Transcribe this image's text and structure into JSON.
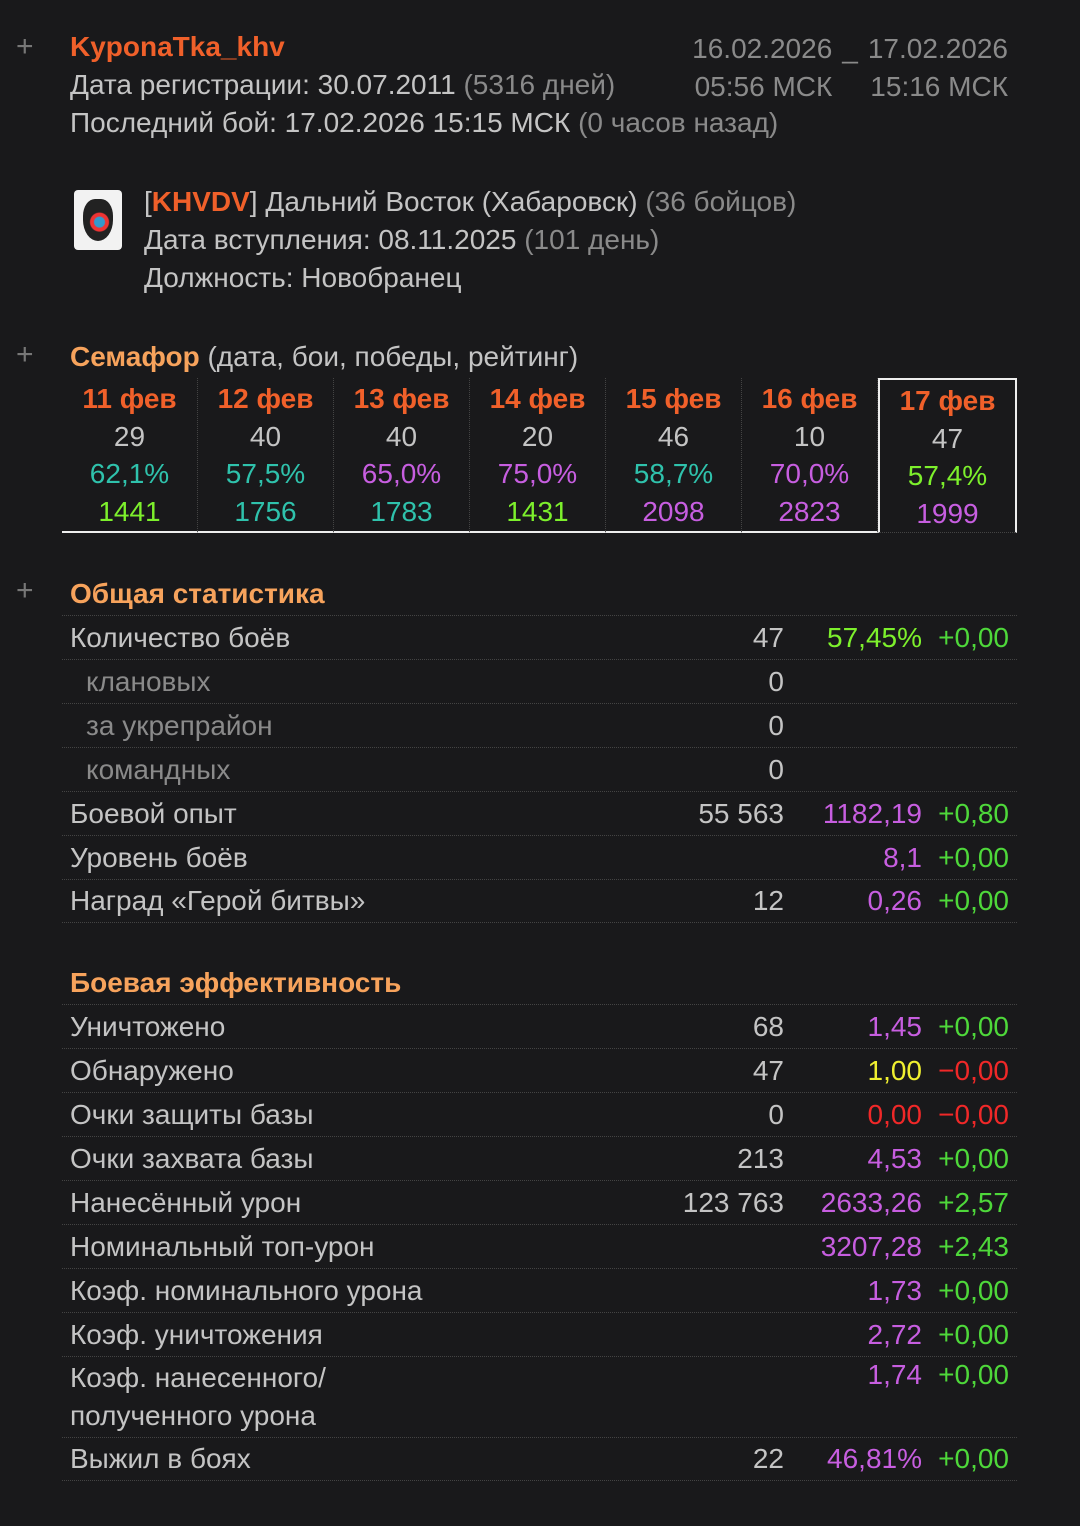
{
  "player": {
    "name": "KyponaTka_khv",
    "reg_label": "Дата регистрации: 30.07.2011",
    "reg_days": "(5316 дней)",
    "last_label": "Последний бой: 17.02.2026 15:15 МСК",
    "last_ago": "(0 часов назад)"
  },
  "period": {
    "from_date": "16.02.2026",
    "sep": "_",
    "to_date": "17.02.2026",
    "from_time": "05:56 МСК",
    "to_time": "15:16 МСК"
  },
  "clan": {
    "open": "[",
    "tag": "KHVDV",
    "close": "]",
    "name": "Дальний Восток (Хабаровск)",
    "members": "(36 бойцов)",
    "joined": "Дата вступления: 08.11.2025",
    "joined_days": "(101 день)",
    "role": "Должность: Новобранец"
  },
  "semaphore": {
    "title": "Семафор",
    "subtitle": "(дата, бои, победы, рейтинг)",
    "days": [
      {
        "date": "11 фев",
        "battles": "29",
        "wins": "62,1%",
        "wins_color": "c",
        "rating": "1441",
        "rating_color": "g"
      },
      {
        "date": "12 фев",
        "battles": "40",
        "wins": "57,5%",
        "wins_color": "c",
        "rating": "1756",
        "rating_color": "c"
      },
      {
        "date": "13 фев",
        "battles": "40",
        "wins": "65,0%",
        "wins_color": "p",
        "rating": "1783",
        "rating_color": "c"
      },
      {
        "date": "14 фев",
        "battles": "20",
        "wins": "75,0%",
        "wins_color": "p",
        "rating": "1431",
        "rating_color": "g"
      },
      {
        "date": "15 фев",
        "battles": "46",
        "wins": "58,7%",
        "wins_color": "c",
        "rating": "2098",
        "rating_color": "p"
      },
      {
        "date": "16 фев",
        "battles": "10",
        "wins": "70,0%",
        "wins_color": "p",
        "rating": "2823",
        "rating_color": "p"
      },
      {
        "date": "17 фев",
        "battles": "47",
        "wins": "57,4%",
        "wins_color": "g",
        "rating": "1999",
        "rating_color": "p"
      }
    ]
  },
  "general": {
    "title": "Общая статистика",
    "rows": [
      {
        "label": "Количество боёв",
        "value": "47",
        "ratio": "57,45%",
        "rc": "g",
        "delta": "+0,00",
        "dc": "gd"
      },
      {
        "label": "клановых",
        "value": "0",
        "ratio": "",
        "rc": "",
        "delta": "",
        "dc": "",
        "sub": true
      },
      {
        "label": "за укрепрайон",
        "value": "0",
        "ratio": "",
        "rc": "",
        "delta": "",
        "dc": "",
        "sub": true
      },
      {
        "label": "командных",
        "value": "0",
        "ratio": "",
        "rc": "",
        "delta": "",
        "dc": "",
        "sub": true
      },
      {
        "label": "Боевой опыт",
        "value": "55 563",
        "ratio": "1182,19",
        "rc": "p",
        "delta": "+0,80",
        "dc": "gd"
      },
      {
        "label": "Уровень боёв",
        "value": "",
        "ratio": "8,1",
        "rc": "p",
        "delta": "+0,00",
        "dc": "gd"
      },
      {
        "label": "Наград «Герой битвы»",
        "value": "12",
        "ratio": "0,26",
        "rc": "p",
        "delta": "+0,00",
        "dc": "gd"
      }
    ]
  },
  "efficiency": {
    "title": "Боевая эффективность",
    "rows": [
      {
        "label": "Уничтожено",
        "value": "68",
        "ratio": "1,45",
        "rc": "p",
        "delta": "+0,00",
        "dc": "gd"
      },
      {
        "label": "Обнаружено",
        "value": "47",
        "ratio": "1,00",
        "rc": "y",
        "delta": "−0,00",
        "dc": "r"
      },
      {
        "label": "Очки защиты базы",
        "value": "0",
        "ratio": "0,00",
        "rc": "r",
        "delta": "−0,00",
        "dc": "r"
      },
      {
        "label": "Очки захвата базы",
        "value": "213",
        "ratio": "4,53",
        "rc": "p",
        "delta": "+0,00",
        "dc": "gd"
      },
      {
        "label": "Нанесённый урон",
        "value": "123 763",
        "ratio": "2633,26",
        "rc": "p",
        "delta": "+2,57",
        "dc": "gd"
      },
      {
        "label": "Номинальный топ-урон",
        "value": "",
        "ratio": "3207,28",
        "rc": "p",
        "delta": "+2,43",
        "dc": "gd"
      },
      {
        "label": "Коэф. номинального урона",
        "value": "",
        "ratio": "1,73",
        "rc": "p",
        "delta": "+0,00",
        "dc": "gd"
      },
      {
        "label": "Коэф. уничтожения",
        "value": "",
        "ratio": "2,72",
        "rc": "p",
        "delta": "+0,00",
        "dc": "gd"
      },
      {
        "label": "Коэф. нанесенного/\nполученного урона",
        "value": "",
        "ratio": "1,74",
        "rc": "p",
        "delta": "+0,00",
        "dc": "gd"
      },
      {
        "label": "Выжил в боях",
        "value": "22",
        "ratio": "46,81%",
        "rc": "p",
        "delta": "+0,00",
        "dc": "gd"
      }
    ]
  }
}
